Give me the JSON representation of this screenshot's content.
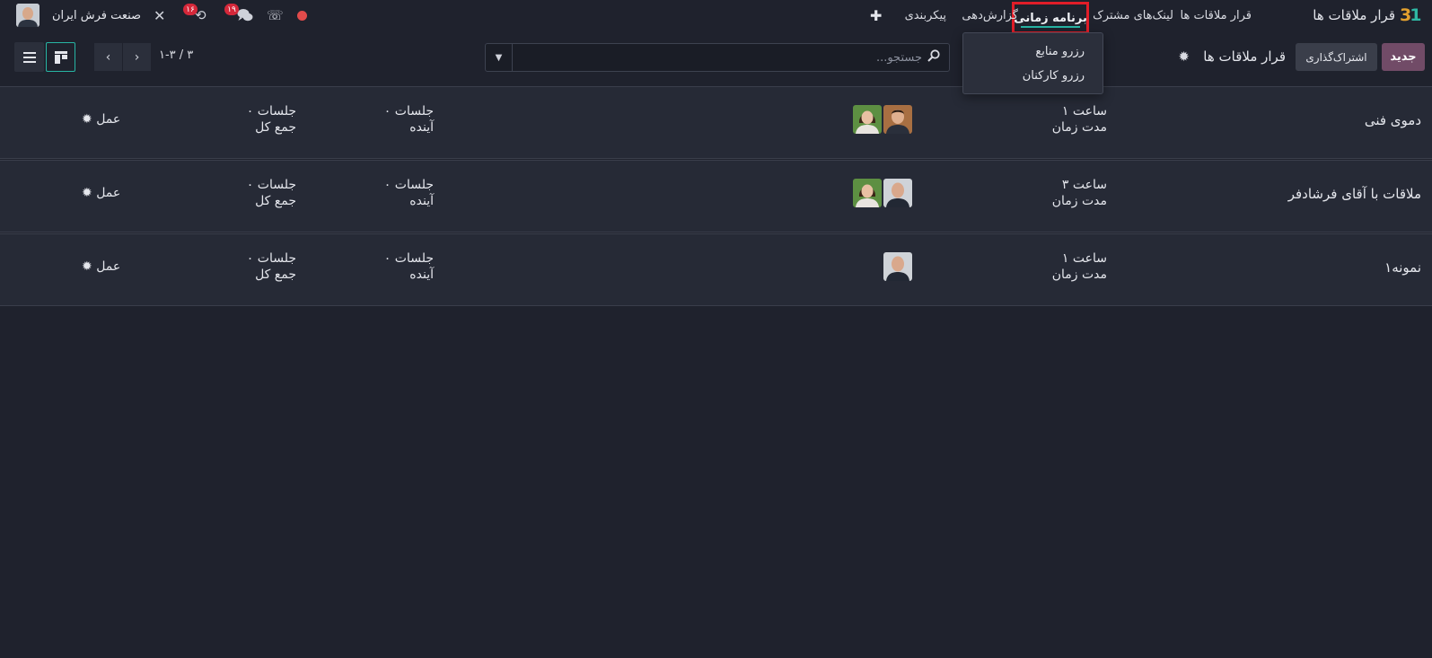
{
  "navbar": {
    "app_logo": "31",
    "app_name": "قرار ملاقات ها",
    "menu": {
      "appointments": "قرار ملاقات ها",
      "shared_links": "لینک‌های مشترک",
      "scheduling": "برنامه زمانی",
      "reporting": "گزارش‌دهی",
      "configuration": "پیکربندی"
    },
    "plus_icon": "plus-icon",
    "messages_badge": "۱۹",
    "activity_badge": "۱۶",
    "company": "صنعت فرش ایران",
    "colors": {
      "record_dot": "#e14b4b",
      "badge": "#d5283a",
      "active_frame": "#e11d28",
      "accent": "#27b5a4"
    }
  },
  "dropdown": {
    "items": [
      "رزرو منابع",
      "رزرو کارکنان"
    ]
  },
  "control_panel": {
    "new_button": "جدید",
    "share_button": "اشتراک‌گذاری",
    "title": "قرار ملاقات ها",
    "search_placeholder": "جستجو...",
    "pager": "۱-۳ / ۳",
    "colors": {
      "new_button": "#714b67"
    }
  },
  "rows": [
    {
      "name": "دموی فنی",
      "duration_value": "۱ ساعت",
      "duration_label": "مدت زمان",
      "upcoming_value": "۰ جلسات",
      "upcoming_label": "آینده",
      "total_value": "۰ جلسات",
      "total_label": "جمع کل",
      "action": "عمل",
      "avatars": [
        "man-avatar",
        "woman-avatar"
      ]
    },
    {
      "name": "ملاقات با آقای فرشادفر",
      "duration_value": "۳ ساعت",
      "duration_label": "مدت زمان",
      "upcoming_value": "۰ جلسات",
      "upcoming_label": "آینده",
      "total_value": "۰ جلسات",
      "total_label": "جمع کل",
      "action": "عمل",
      "avatars": [
        "bald-man-avatar",
        "woman-avatar"
      ]
    },
    {
      "name": "نمونه۱",
      "duration_value": "۱ ساعت",
      "duration_label": "مدت زمان",
      "upcoming_value": "۰ جلسات",
      "upcoming_label": "آینده",
      "total_value": "۰ جلسات",
      "total_label": "جمع کل",
      "action": "عمل",
      "avatars": [
        "bald-man-avatar"
      ]
    }
  ]
}
